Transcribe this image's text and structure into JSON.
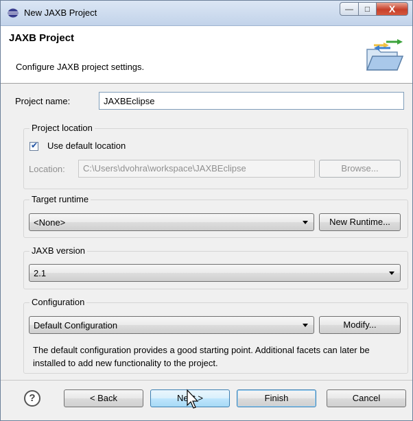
{
  "window": {
    "title": "New JAXB Project",
    "controls": {
      "minimize": "—",
      "maximize": "□",
      "close": "X"
    }
  },
  "header": {
    "title": "JAXB Project",
    "description": "Configure JAXB project settings.",
    "icon": "new-project-folder-icon"
  },
  "project_name": {
    "label": "Project name:",
    "value": "JAXBEclipse"
  },
  "project_location": {
    "group_label": "Project location",
    "use_default_label": "Use default location",
    "use_default_checked": true,
    "location_label": "Location:",
    "location_value": "C:\\Users\\dvohra\\workspace\\JAXBEclipse",
    "browse_label": "Browse..."
  },
  "target_runtime": {
    "group_label": "Target runtime",
    "selected": "<None>",
    "new_runtime_label": "New Runtime..."
  },
  "jaxb_version": {
    "group_label": "JAXB version",
    "selected": "2.1"
  },
  "configuration": {
    "group_label": "Configuration",
    "selected": "Default Configuration",
    "modify_label": "Modify...",
    "description": "The default configuration provides a good starting point. Additional facets can later be installed to add new functionality to the project."
  },
  "footer": {
    "help_icon": "?",
    "back_label": "< Back",
    "next_label": "Next >",
    "finish_label": "Finish",
    "cancel_label": "Cancel"
  },
  "colors": {
    "title_bar": "#c2d3ea",
    "close_button": "#c7402a",
    "dialog_background": "#f0f0f0",
    "button_focus_border": "#3c7fb1"
  }
}
